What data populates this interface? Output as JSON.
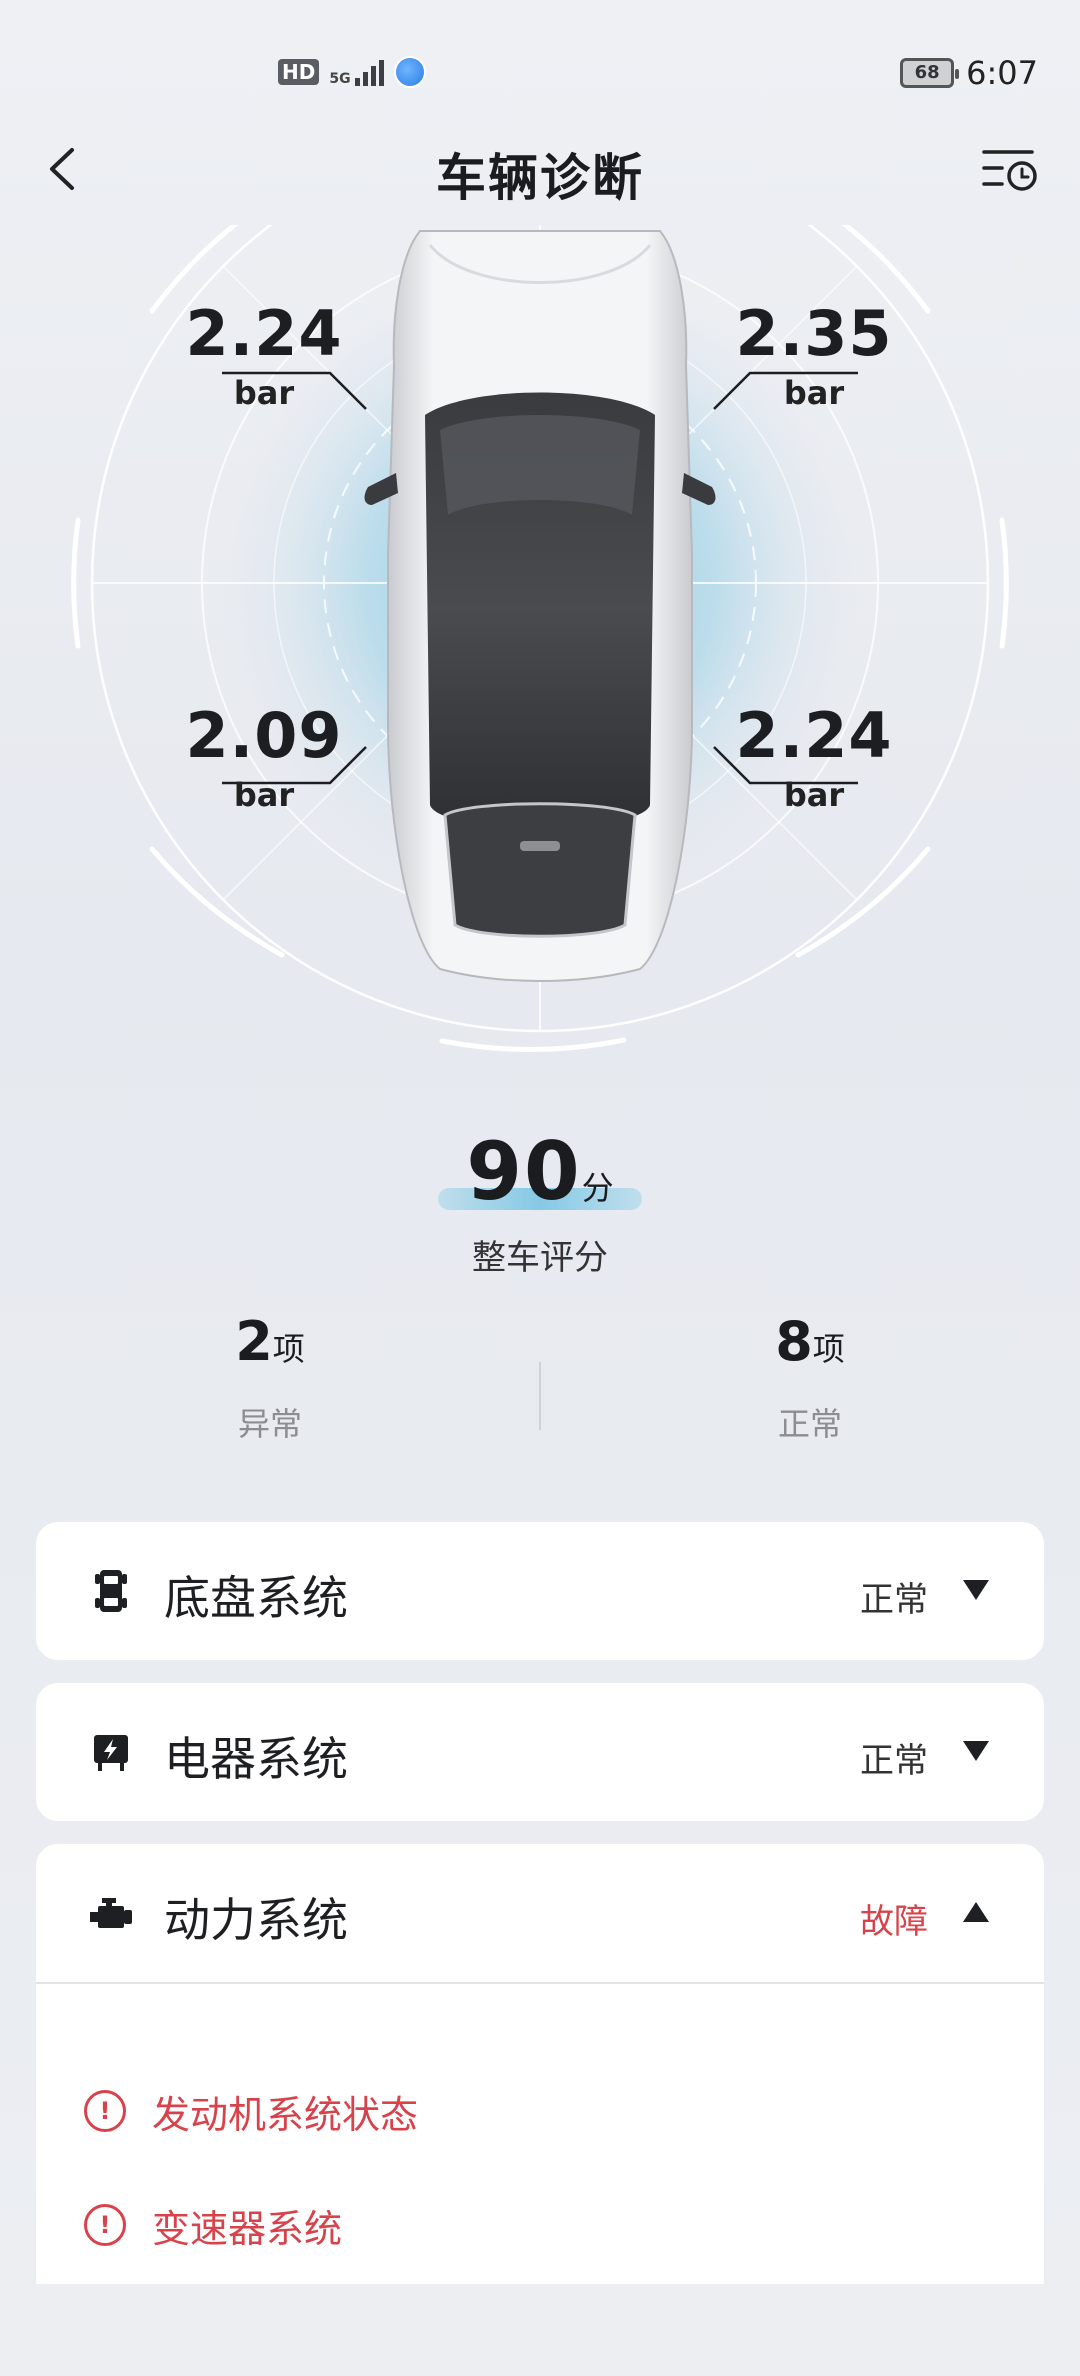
{
  "status_bar": {
    "hd": "HD",
    "network": "5G",
    "battery": "68",
    "time": "6:07"
  },
  "header": {
    "title": "车辆诊断",
    "back_icon": "chevron-left-icon",
    "history_icon": "list-clock-icon"
  },
  "tires": {
    "front_left": {
      "value": "2.24",
      "unit": "bar"
    },
    "front_right": {
      "value": "2.35",
      "unit": "bar"
    },
    "rear_left": {
      "value": "2.09",
      "unit": "bar"
    },
    "rear_right": {
      "value": "2.24",
      "unit": "bar"
    }
  },
  "score": {
    "value": "90",
    "unit": "分",
    "label": "整车评分"
  },
  "stats": {
    "abnormal": {
      "count": "2",
      "unit": "项",
      "label": "异常"
    },
    "normal": {
      "count": "8",
      "unit": "项",
      "label": "正常"
    }
  },
  "systems": [
    {
      "title": "底盘系统",
      "status": "正常",
      "icon": "chassis-icon",
      "expanded": false
    },
    {
      "title": "电器系统",
      "status": "正常",
      "icon": "electrical-icon",
      "expanded": false
    },
    {
      "title": "动力系统",
      "status": "故障",
      "icon": "engine-icon",
      "expanded": true,
      "faults": [
        "发动机系统状态",
        "变速器系统"
      ]
    }
  ],
  "colors": {
    "fault": "#d8434b",
    "accent_glow": "#9fd3e8"
  }
}
